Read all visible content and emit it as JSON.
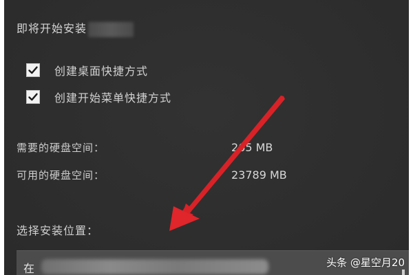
{
  "dialog": {
    "title": "即将开始安装"
  },
  "options": [
    {
      "label": "创建桌面快捷方式",
      "checked": true
    },
    {
      "label": "创建开始菜单快捷方式",
      "checked": true
    }
  ],
  "disk": {
    "required_label": "需要的硬盘空间：",
    "required_value": "265 MB",
    "available_label": "可用的硬盘空间：",
    "available_value": "23789 MB"
  },
  "location": {
    "label": "选择安装位置：",
    "path_prefix": "在"
  },
  "watermark": "头条 @星空月20",
  "colors": {
    "dialog_bg": "#2e2e2e",
    "text": "#d2d2d2",
    "arrow": "#e2242a",
    "checkbox_bg": "#f2f2f2"
  },
  "icons": {
    "checkbox": "check-mark-icon",
    "annotation": "red-arrow-icon"
  }
}
